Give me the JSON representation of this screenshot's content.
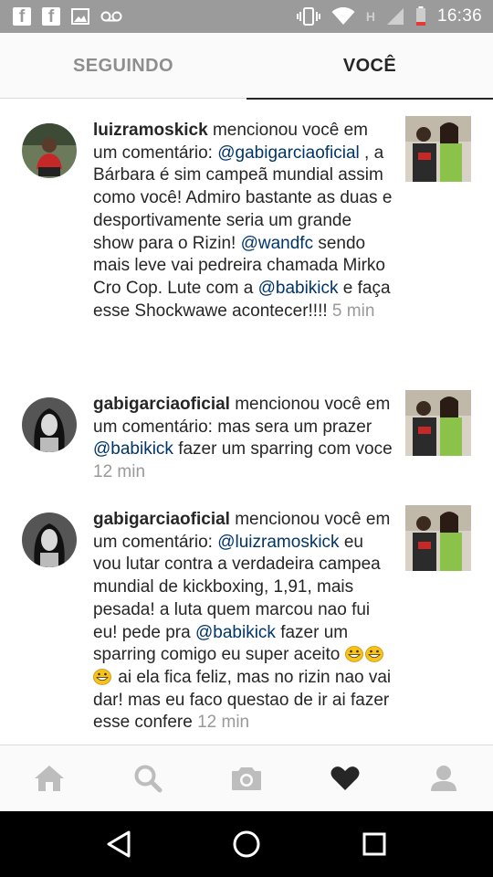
{
  "status_bar": {
    "time": "16:36",
    "network_label": "H",
    "icons": [
      "facebook-icon",
      "facebook-icon",
      "image-icon",
      "voicemail-icon",
      "vibrate-icon",
      "wifi-icon",
      "signal-icon",
      "battery-low-icon"
    ]
  },
  "tabs": [
    {
      "label": "SEGUINDO",
      "active": false
    },
    {
      "label": "VOCÊ",
      "active": true
    }
  ],
  "notifications": [
    {
      "username": "luizramoskick",
      "action": " mencionou você em um comentário: ",
      "parts": [
        {
          "mention": "@gabigarciaoficial"
        },
        {
          "text": " , a Bárbara é sim campeã mundial assim como você! Admiro bastante as duas e desportivamente seria um grande show para o Rizin! "
        },
        {
          "mention": "@wandfc"
        },
        {
          "text": " sendo mais leve vai pedreira chamada Mirko Cro Cop. Lute com a "
        },
        {
          "mention": "@babikick"
        },
        {
          "text": " e faça esse Shockwawe acontecer!!!! "
        }
      ],
      "time": "5 min"
    },
    {
      "username": "gabigarciaoficial",
      "action": " mencionou você em um comentário: ",
      "parts": [
        {
          "text": "mas sera um prazer "
        },
        {
          "mention": "@babikick"
        },
        {
          "text": " fazer um sparring com voce "
        }
      ],
      "time": "12 min"
    },
    {
      "username": "gabigarciaoficial",
      "action": " mencionou você em um comentário: ",
      "parts": [
        {
          "mention": "@luizramoskick"
        },
        {
          "text": " eu vou lutar contra a verdadeira campea mundial de kickboxing, 1,91, mais pesada! a luta quem marcou nao fui eu! pede pra "
        },
        {
          "mention": "@babikick"
        },
        {
          "text": " fazer um sparring comigo eu super aceito "
        },
        {
          "emoji": "grinning-emoji"
        },
        {
          "emoji": "grinning-emoji"
        },
        {
          "emoji": "grinning-emoji"
        },
        {
          "text": " ai ela fica feliz, mas no rizin nao vai dar! mas eu faco questao de ir ai fazer esse confere "
        }
      ],
      "time": "12 min"
    }
  ],
  "bottom_nav": [
    "home-icon",
    "search-icon",
    "camera-icon",
    "heart-icon",
    "profile-icon"
  ],
  "system_nav": [
    "back-icon",
    "home-circle-icon",
    "recents-icon"
  ]
}
